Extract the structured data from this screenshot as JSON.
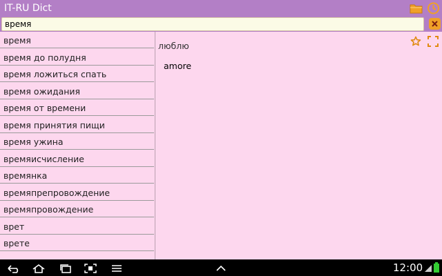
{
  "app": {
    "title": "IT-RU Dict"
  },
  "search": {
    "value": "время",
    "placeholder": ""
  },
  "list": {
    "items": [
      "время",
      "время до полудня",
      "время ложиться спать",
      "время ожидания",
      "время от времени",
      "время принятия пищи",
      "время ужина",
      "времяисчисление",
      "времянка",
      "времяпрепровождение",
      "времяпровождение",
      "врет",
      "врете"
    ]
  },
  "detail": {
    "word": "люблю",
    "translation": "amore"
  },
  "icons": {
    "folder": "folder-icon",
    "history": "history-icon",
    "clear": "clear-icon",
    "favorite": "star-icon",
    "fullscreen": "expand-icon"
  },
  "status": {
    "clock": "12:00"
  },
  "colors": {
    "titlebar": "#b37fc6",
    "background": "#fdd7ee",
    "accent": "#f0a028"
  }
}
